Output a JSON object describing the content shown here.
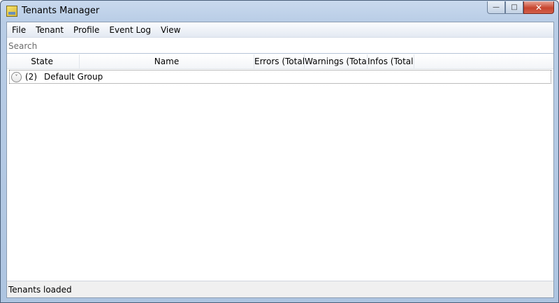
{
  "window": {
    "title": "Tenants Manager"
  },
  "caption": {
    "minimize": "—",
    "maximize": "□",
    "close": "✕"
  },
  "menu": {
    "items": [
      "File",
      "Tenant",
      "Profile",
      "Event Log",
      "View"
    ]
  },
  "search": {
    "placeholder": "Search"
  },
  "grid": {
    "columns": [
      "State",
      "Name",
      "Errors (Total)",
      "Warnings (Total)",
      "Infos (Total)"
    ],
    "groups": [
      {
        "count": "(2)",
        "name": "Default Group",
        "expander": "˅"
      }
    ]
  },
  "status": {
    "text": "Tenants loaded"
  }
}
